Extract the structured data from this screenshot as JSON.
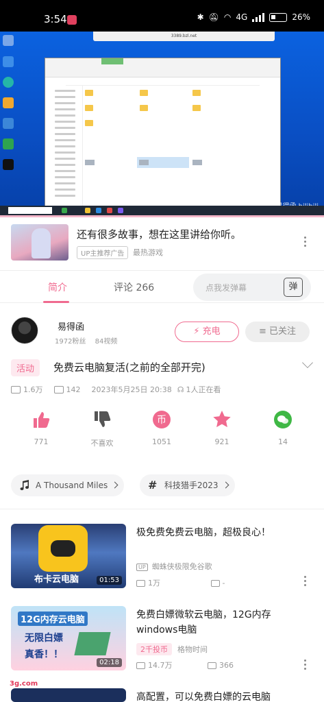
{
  "status_bar": {
    "time": "3:54",
    "network": "4G",
    "battery": "26%"
  },
  "player": {
    "url_bar": "3389.bzl.net",
    "watermark": "易得函 bilibili"
  },
  "ad": {
    "title": "还有很多故事，想在这里讲给你听。",
    "tag": "UP主推荐广告",
    "category": "最热游戏"
  },
  "tabs": {
    "intro": "简介",
    "comments": "评论 266",
    "danmaku_placeholder": "点我发弹幕",
    "danmaku_button": "弹"
  },
  "uploader": {
    "name": "易得函",
    "followers": "1972粉丝",
    "videos": "84视频",
    "charge_label": "充电",
    "follow_label": "已关注"
  },
  "video": {
    "badge": "活动",
    "title": "免费云电脑复活(之前的全部开完)",
    "views": "1.6万",
    "danmaku": "142",
    "date": "2023年5月25日 20:38",
    "watching": "1人正在看"
  },
  "actions": {
    "like": "771",
    "dislike": "不喜欢",
    "coin": "1051",
    "favorite": "921",
    "share": "14"
  },
  "tags": {
    "music": "A Thousand Miles",
    "topic": "科技猎手2023"
  },
  "recommendations": [
    {
      "title": "极免费免费云电脑，超极良心！",
      "uploader": "蜘蛛侠极限免谷歌",
      "views": "1万",
      "danmaku": "-",
      "duration": "01:53",
      "thumb_text": "布卡云电脑"
    },
    {
      "title": "免费白嫖微软云电脑，12G内存windows电脑",
      "tag": "2千投币",
      "uploader": "格物时间",
      "views": "14.7万",
      "danmaku": "366",
      "duration": "02:18",
      "thumb_text_1": "12G内存云电脑",
      "thumb_text_2": "无限白嫖",
      "thumb_text_3": "真香！！"
    },
    {
      "title": "高配置，可以免费白嫖的云电脑"
    }
  ],
  "site_mark": "3g.com",
  "colors": {
    "accent": "#f06a8f",
    "player_bg": "#0a52c8"
  }
}
